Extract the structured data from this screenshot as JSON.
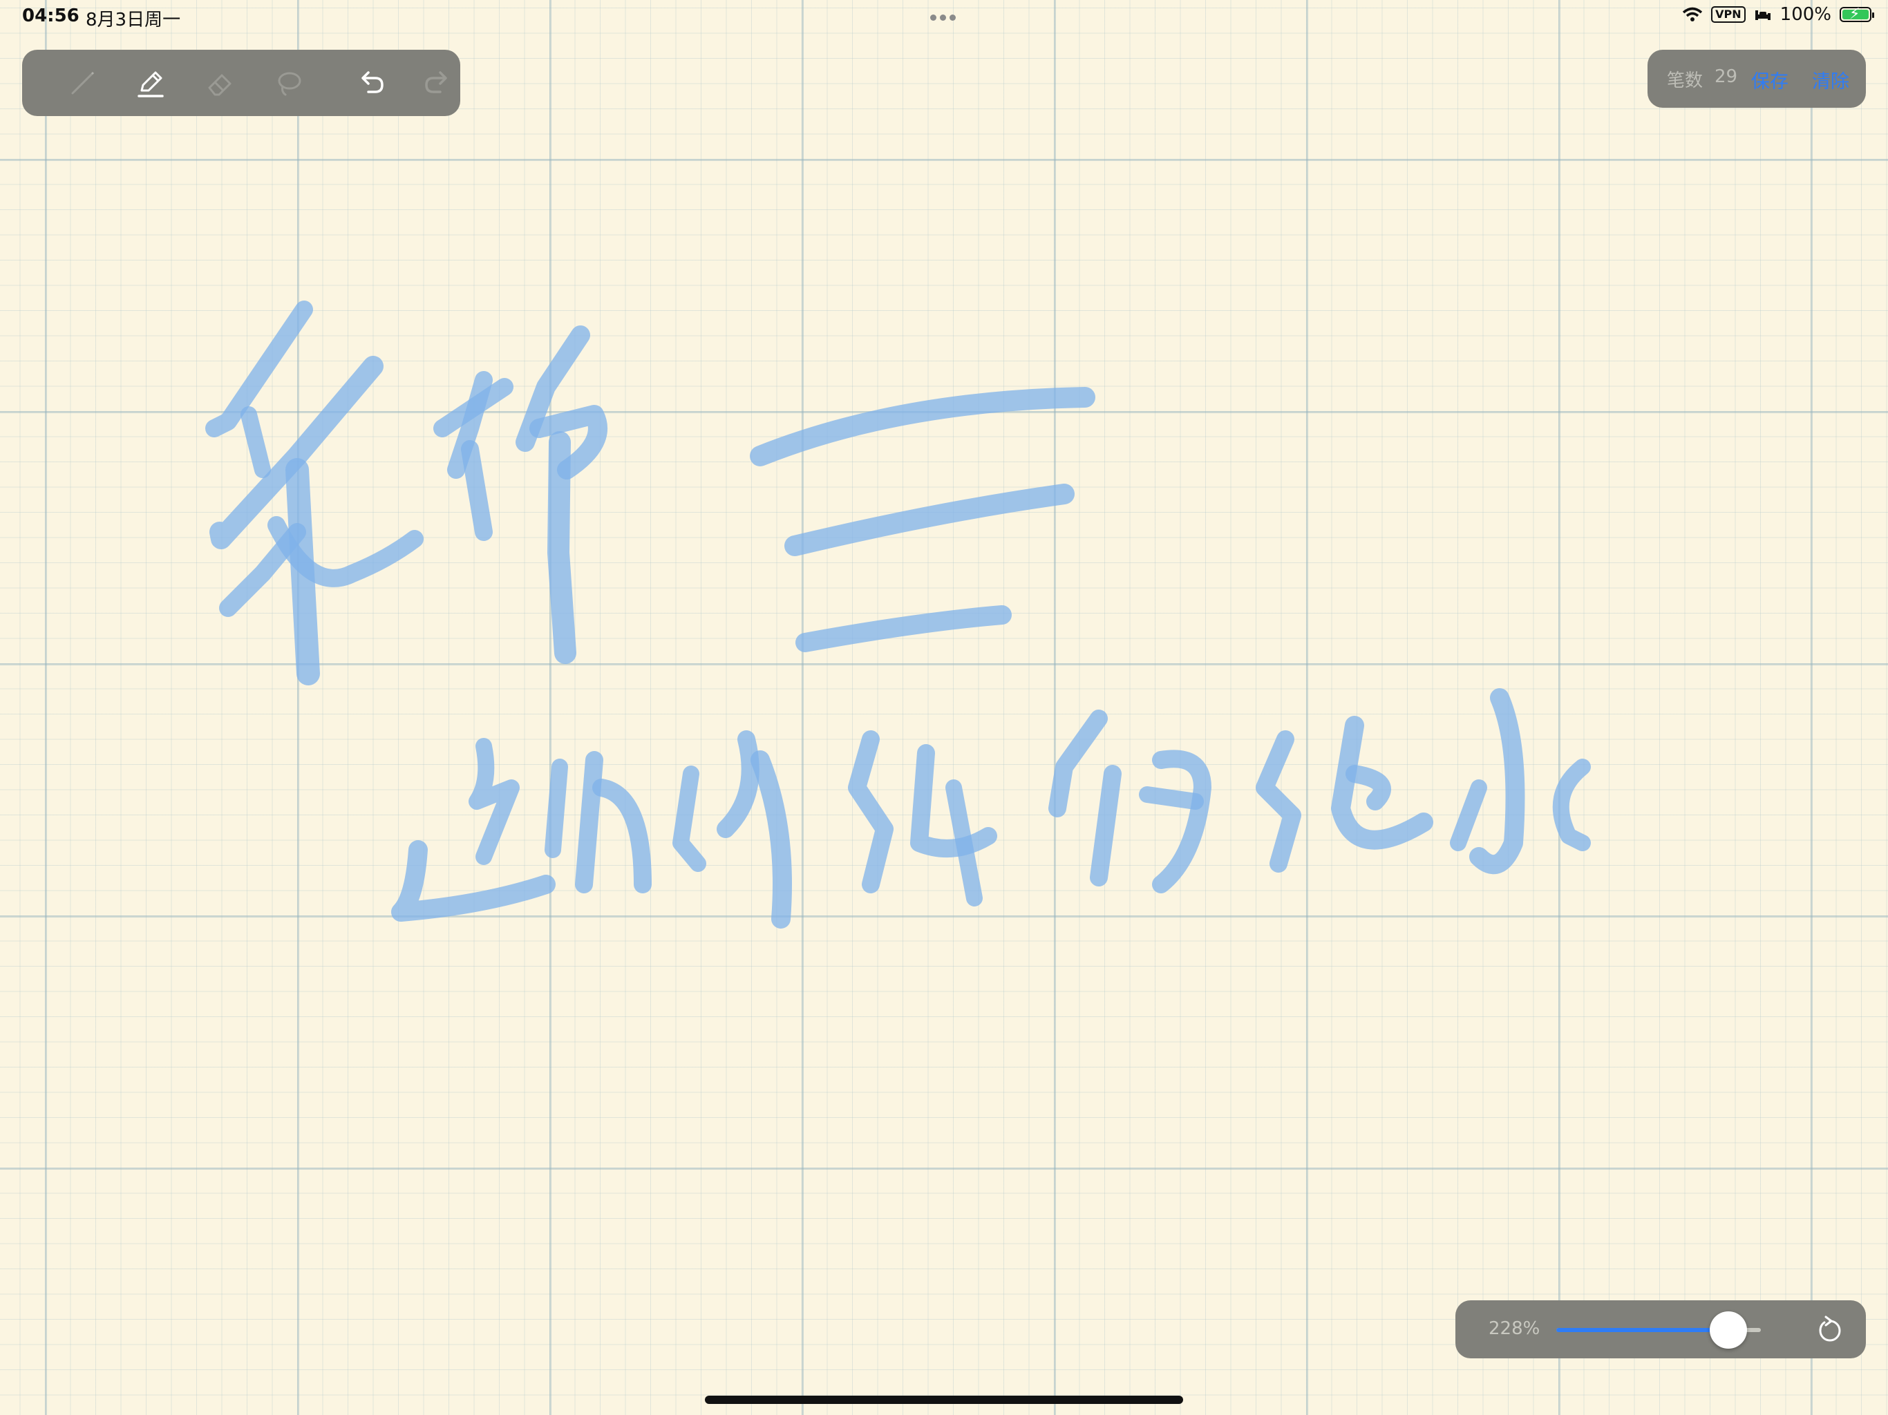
{
  "status_bar": {
    "time": "04:56",
    "date": "8月3日周一",
    "vpn": "VPN",
    "battery": "100%"
  },
  "toolbar": {
    "tools": [
      {
        "name": "pen-icon",
        "active": false
      },
      {
        "name": "highlighter-icon",
        "active": true
      },
      {
        "name": "eraser-icon",
        "active": false
      },
      {
        "name": "lasso-icon",
        "active": false
      },
      {
        "name": "undo-icon",
        "active": false
      },
      {
        "name": "redo-icon",
        "active": false
      }
    ]
  },
  "stats": {
    "stroke_label": "笔数",
    "stroke_count": "29",
    "save_label": "保存",
    "clear_label": "清除"
  },
  "zoom": {
    "value": "228%",
    "level": 0.84
  },
  "colors": {
    "paper": "#fbf5e1",
    "ink": "#7fb2ea",
    "panel": "#80807a",
    "accent": "#2e7cf6"
  }
}
